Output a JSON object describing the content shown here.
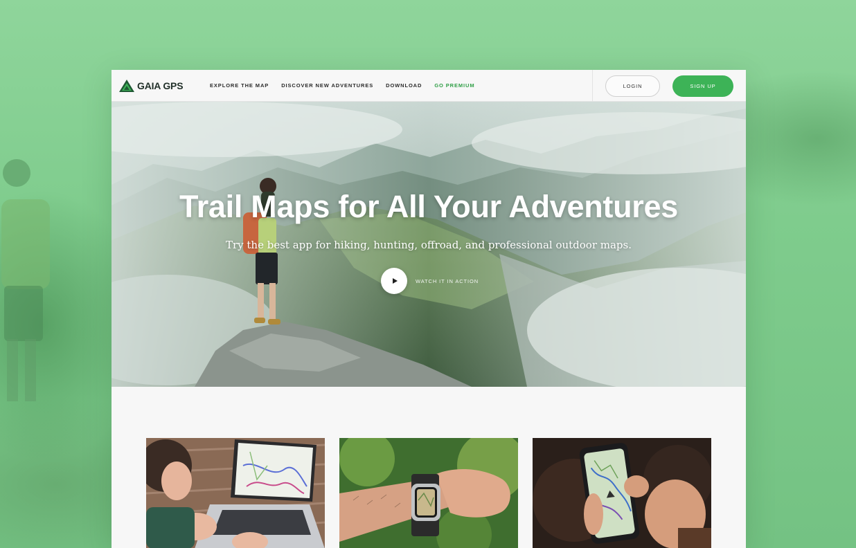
{
  "brand": {
    "name": "GAIA GPS",
    "accent_color": "#3db357"
  },
  "nav": {
    "links": [
      {
        "label": "EXPLORE THE MAP"
      },
      {
        "label": "DISCOVER NEW ADVENTURES"
      },
      {
        "label": "DOWNLOAD"
      },
      {
        "label": "GO PREMIUM"
      }
    ],
    "login_label": "LOGIN",
    "signup_label": "SIGN UP"
  },
  "hero": {
    "title": "Trail Maps for All Your Adventures",
    "subtitle": "Try the best app for hiking, hunting, offroad, and professional outdoor maps.",
    "play_icon": "play-icon",
    "video_label": "WATCH IT IN ACTION"
  },
  "cards": [
    {
      "image": "laptop-with-map"
    },
    {
      "image": "smartwatch-on-wrist"
    },
    {
      "image": "phone-with-map"
    }
  ]
}
